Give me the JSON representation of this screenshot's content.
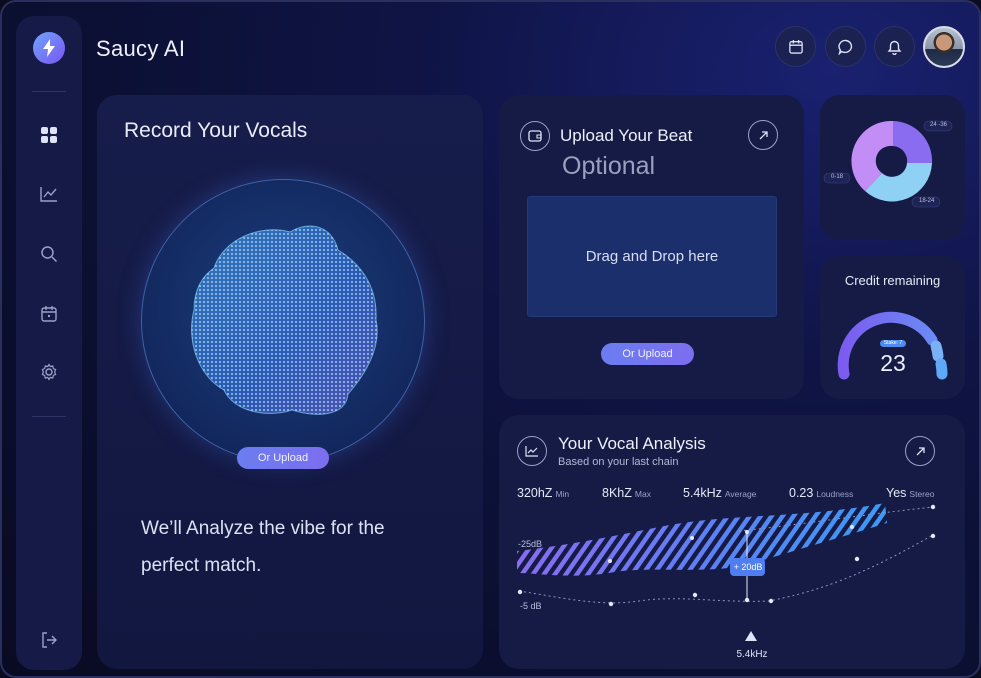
{
  "app": {
    "title": "Saucy AI"
  },
  "sidebar": {
    "items": [
      {
        "name": "dashboard",
        "icon": "grid-icon"
      },
      {
        "name": "analytics",
        "icon": "trend-icon"
      },
      {
        "name": "search",
        "icon": "search-icon"
      },
      {
        "name": "calendar",
        "icon": "calendar-icon"
      },
      {
        "name": "settings",
        "icon": "gear-icon"
      }
    ],
    "logout_icon": "logout-icon"
  },
  "header": {
    "buttons": [
      "calendar-icon",
      "chat-icon",
      "bell-icon"
    ],
    "avatar": "user-avatar"
  },
  "record": {
    "title": "Record Your Vocals",
    "upload_label": "Or Upload",
    "tagline": "We’ll Analyze the vibe for the perfect match."
  },
  "upload": {
    "title": "Upload Your Beat",
    "subtitle": "Optional",
    "dropzone_text": "Drag and Drop here",
    "upload_label": "Or Upload"
  },
  "donut": {
    "labels": [
      "24 -36",
      "0-18",
      "18-24"
    ],
    "colors": [
      "#8a6cf0",
      "#c28ef5",
      "#8fd0f5"
    ]
  },
  "credit": {
    "title": "Credit remaining",
    "badge": "Stake: 7",
    "value": "23"
  },
  "analysis": {
    "title": "Your Vocal Analysis",
    "subtitle": "Based on your last chain",
    "stats": [
      {
        "value": "320hZ",
        "label": "Min"
      },
      {
        "value": "8KhZ",
        "label": "Max"
      },
      {
        "value": "5.4kHz",
        "label": "Average"
      },
      {
        "value": "0.23",
        "label": "Loudness"
      },
      {
        "value": "Yes",
        "label": "Stereo"
      }
    ],
    "db_top": "-25dB",
    "db_bottom": "-5 dB",
    "marker_label": "+ 20dB",
    "slider_label": "5.4kHz",
    "slider_value": 0.55
  }
}
